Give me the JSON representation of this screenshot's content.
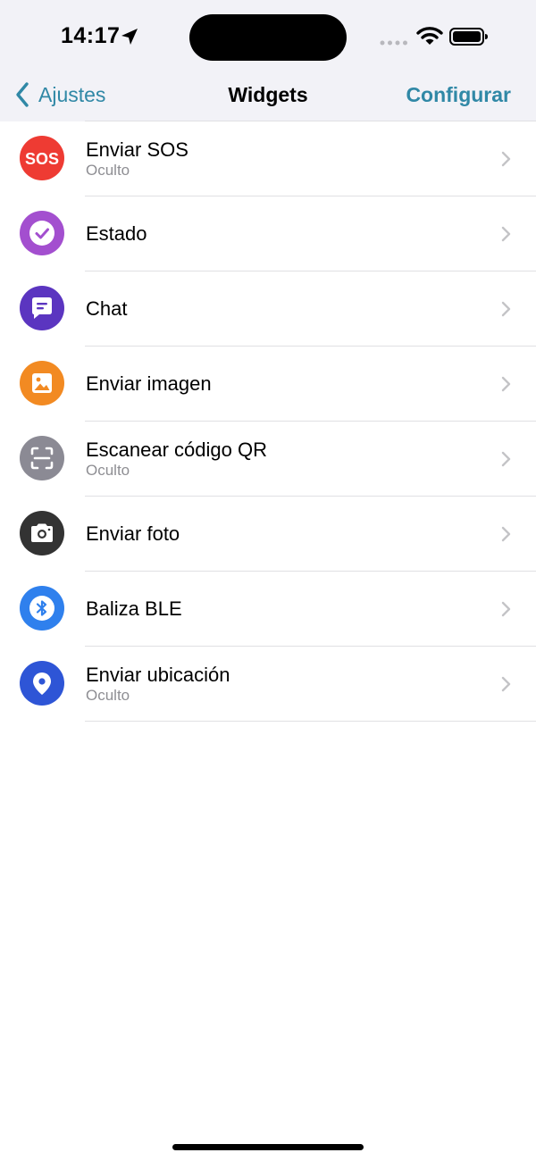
{
  "status_bar": {
    "time": "14:17"
  },
  "nav": {
    "back_label": "Ajustes",
    "title": "Widgets",
    "action_label": "Configurar",
    "accent_color": "#3088a6"
  },
  "widgets": [
    {
      "title": "Enviar SOS",
      "subtitle": "Oculto",
      "icon": "sos-icon",
      "icon_text": "SOS",
      "color": "#ee3b33"
    },
    {
      "title": "Estado",
      "subtitle": "",
      "icon": "check-icon",
      "color": "#a34fcf"
    },
    {
      "title": "Chat",
      "subtitle": "",
      "icon": "chat-bubble-icon",
      "color": "#5b35c0"
    },
    {
      "title": "Enviar imagen",
      "subtitle": "",
      "icon": "image-icon",
      "color": "#f28a22"
    },
    {
      "title": "Escanear código QR",
      "subtitle": "Oculto",
      "icon": "qr-scan-icon",
      "color": "#8b8a94"
    },
    {
      "title": "Enviar foto",
      "subtitle": "",
      "icon": "camera-icon",
      "color": "#333333"
    },
    {
      "title": "Baliza BLE",
      "subtitle": "",
      "icon": "bluetooth-icon",
      "color": "#2f80ed"
    },
    {
      "title": "Enviar ubicación",
      "subtitle": "Oculto",
      "icon": "location-pin-icon",
      "color": "#2e55d6"
    }
  ]
}
